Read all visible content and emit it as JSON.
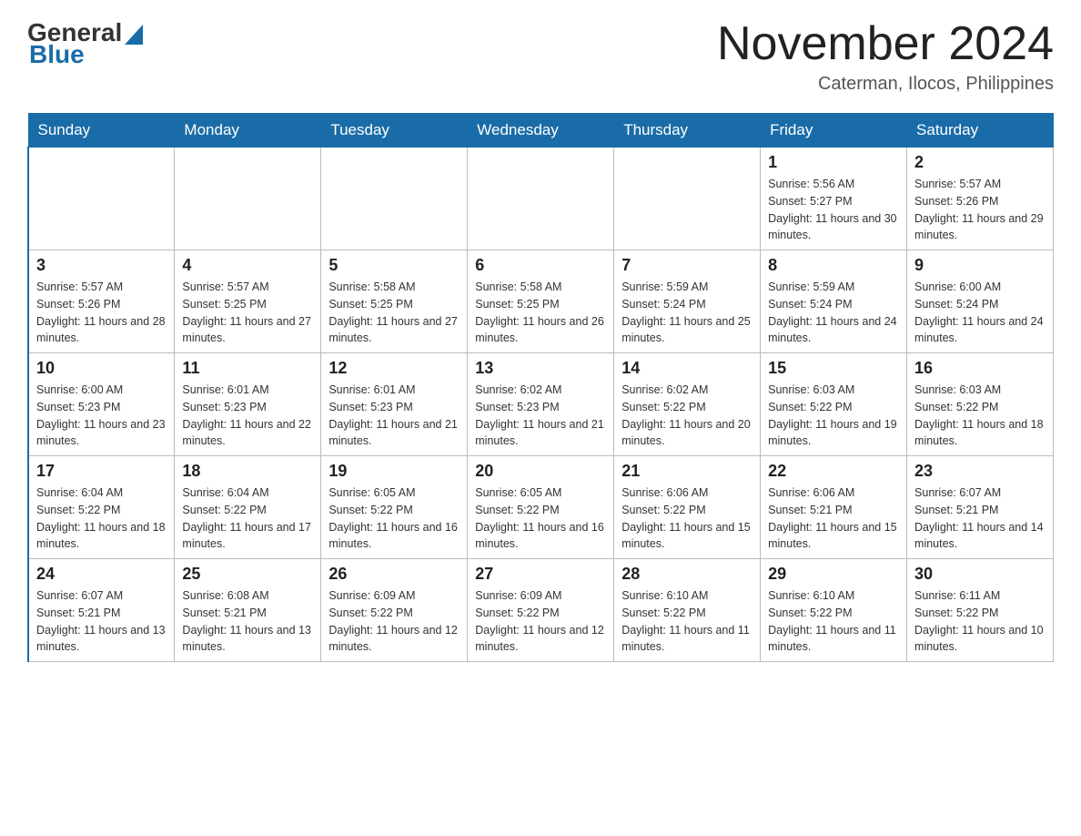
{
  "header": {
    "logo": {
      "text1": "General",
      "text2": "Blue"
    },
    "title": "November 2024",
    "location": "Caterman, Ilocos, Philippines"
  },
  "days_of_week": [
    "Sunday",
    "Monday",
    "Tuesday",
    "Wednesday",
    "Thursday",
    "Friday",
    "Saturday"
  ],
  "weeks": [
    [
      {
        "day": "",
        "sunrise": "",
        "sunset": "",
        "daylight": ""
      },
      {
        "day": "",
        "sunrise": "",
        "sunset": "",
        "daylight": ""
      },
      {
        "day": "",
        "sunrise": "",
        "sunset": "",
        "daylight": ""
      },
      {
        "day": "",
        "sunrise": "",
        "sunset": "",
        "daylight": ""
      },
      {
        "day": "",
        "sunrise": "",
        "sunset": "",
        "daylight": ""
      },
      {
        "day": "1",
        "sunrise": "Sunrise: 5:56 AM",
        "sunset": "Sunset: 5:27 PM",
        "daylight": "Daylight: 11 hours and 30 minutes."
      },
      {
        "day": "2",
        "sunrise": "Sunrise: 5:57 AM",
        "sunset": "Sunset: 5:26 PM",
        "daylight": "Daylight: 11 hours and 29 minutes."
      }
    ],
    [
      {
        "day": "3",
        "sunrise": "Sunrise: 5:57 AM",
        "sunset": "Sunset: 5:26 PM",
        "daylight": "Daylight: 11 hours and 28 minutes."
      },
      {
        "day": "4",
        "sunrise": "Sunrise: 5:57 AM",
        "sunset": "Sunset: 5:25 PM",
        "daylight": "Daylight: 11 hours and 27 minutes."
      },
      {
        "day": "5",
        "sunrise": "Sunrise: 5:58 AM",
        "sunset": "Sunset: 5:25 PM",
        "daylight": "Daylight: 11 hours and 27 minutes."
      },
      {
        "day": "6",
        "sunrise": "Sunrise: 5:58 AM",
        "sunset": "Sunset: 5:25 PM",
        "daylight": "Daylight: 11 hours and 26 minutes."
      },
      {
        "day": "7",
        "sunrise": "Sunrise: 5:59 AM",
        "sunset": "Sunset: 5:24 PM",
        "daylight": "Daylight: 11 hours and 25 minutes."
      },
      {
        "day": "8",
        "sunrise": "Sunrise: 5:59 AM",
        "sunset": "Sunset: 5:24 PM",
        "daylight": "Daylight: 11 hours and 24 minutes."
      },
      {
        "day": "9",
        "sunrise": "Sunrise: 6:00 AM",
        "sunset": "Sunset: 5:24 PM",
        "daylight": "Daylight: 11 hours and 24 minutes."
      }
    ],
    [
      {
        "day": "10",
        "sunrise": "Sunrise: 6:00 AM",
        "sunset": "Sunset: 5:23 PM",
        "daylight": "Daylight: 11 hours and 23 minutes."
      },
      {
        "day": "11",
        "sunrise": "Sunrise: 6:01 AM",
        "sunset": "Sunset: 5:23 PM",
        "daylight": "Daylight: 11 hours and 22 minutes."
      },
      {
        "day": "12",
        "sunrise": "Sunrise: 6:01 AM",
        "sunset": "Sunset: 5:23 PM",
        "daylight": "Daylight: 11 hours and 21 minutes."
      },
      {
        "day": "13",
        "sunrise": "Sunrise: 6:02 AM",
        "sunset": "Sunset: 5:23 PM",
        "daylight": "Daylight: 11 hours and 21 minutes."
      },
      {
        "day": "14",
        "sunrise": "Sunrise: 6:02 AM",
        "sunset": "Sunset: 5:22 PM",
        "daylight": "Daylight: 11 hours and 20 minutes."
      },
      {
        "day": "15",
        "sunrise": "Sunrise: 6:03 AM",
        "sunset": "Sunset: 5:22 PM",
        "daylight": "Daylight: 11 hours and 19 minutes."
      },
      {
        "day": "16",
        "sunrise": "Sunrise: 6:03 AM",
        "sunset": "Sunset: 5:22 PM",
        "daylight": "Daylight: 11 hours and 18 minutes."
      }
    ],
    [
      {
        "day": "17",
        "sunrise": "Sunrise: 6:04 AM",
        "sunset": "Sunset: 5:22 PM",
        "daylight": "Daylight: 11 hours and 18 minutes."
      },
      {
        "day": "18",
        "sunrise": "Sunrise: 6:04 AM",
        "sunset": "Sunset: 5:22 PM",
        "daylight": "Daylight: 11 hours and 17 minutes."
      },
      {
        "day": "19",
        "sunrise": "Sunrise: 6:05 AM",
        "sunset": "Sunset: 5:22 PM",
        "daylight": "Daylight: 11 hours and 16 minutes."
      },
      {
        "day": "20",
        "sunrise": "Sunrise: 6:05 AM",
        "sunset": "Sunset: 5:22 PM",
        "daylight": "Daylight: 11 hours and 16 minutes."
      },
      {
        "day": "21",
        "sunrise": "Sunrise: 6:06 AM",
        "sunset": "Sunset: 5:22 PM",
        "daylight": "Daylight: 11 hours and 15 minutes."
      },
      {
        "day": "22",
        "sunrise": "Sunrise: 6:06 AM",
        "sunset": "Sunset: 5:21 PM",
        "daylight": "Daylight: 11 hours and 15 minutes."
      },
      {
        "day": "23",
        "sunrise": "Sunrise: 6:07 AM",
        "sunset": "Sunset: 5:21 PM",
        "daylight": "Daylight: 11 hours and 14 minutes."
      }
    ],
    [
      {
        "day": "24",
        "sunrise": "Sunrise: 6:07 AM",
        "sunset": "Sunset: 5:21 PM",
        "daylight": "Daylight: 11 hours and 13 minutes."
      },
      {
        "day": "25",
        "sunrise": "Sunrise: 6:08 AM",
        "sunset": "Sunset: 5:21 PM",
        "daylight": "Daylight: 11 hours and 13 minutes."
      },
      {
        "day": "26",
        "sunrise": "Sunrise: 6:09 AM",
        "sunset": "Sunset: 5:22 PM",
        "daylight": "Daylight: 11 hours and 12 minutes."
      },
      {
        "day": "27",
        "sunrise": "Sunrise: 6:09 AM",
        "sunset": "Sunset: 5:22 PM",
        "daylight": "Daylight: 11 hours and 12 minutes."
      },
      {
        "day": "28",
        "sunrise": "Sunrise: 6:10 AM",
        "sunset": "Sunset: 5:22 PM",
        "daylight": "Daylight: 11 hours and 11 minutes."
      },
      {
        "day": "29",
        "sunrise": "Sunrise: 6:10 AM",
        "sunset": "Sunset: 5:22 PM",
        "daylight": "Daylight: 11 hours and 11 minutes."
      },
      {
        "day": "30",
        "sunrise": "Sunrise: 6:11 AM",
        "sunset": "Sunset: 5:22 PM",
        "daylight": "Daylight: 11 hours and 10 minutes."
      }
    ]
  ]
}
